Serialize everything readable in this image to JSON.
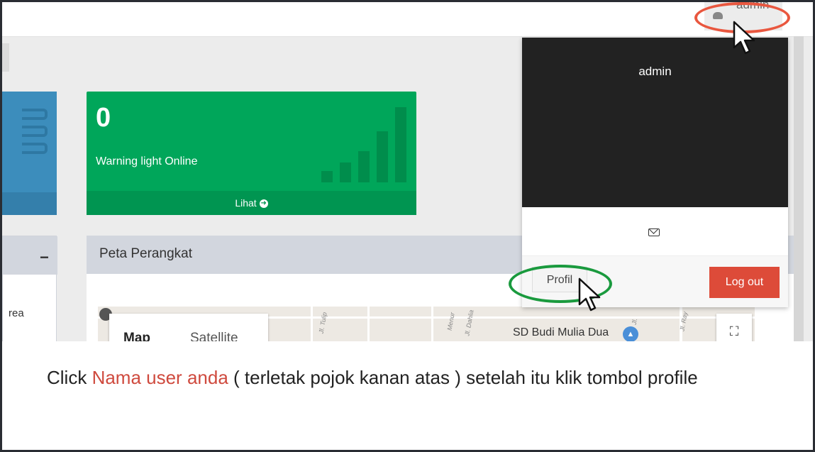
{
  "topbar": {
    "username": "admin"
  },
  "green_box": {
    "count": "0",
    "label": "Warning light Online",
    "link": "Lihat"
  },
  "left_panel": {
    "collapse": "−",
    "fragment": "rea"
  },
  "map_panel": {
    "title": "Peta Perangkat",
    "map_button": "Map",
    "satellite_button": "Satellite",
    "place": "SD Budi Mulia Dua",
    "streets": [
      "Jl. Tulip",
      "Jl. Dahlia",
      "Menur",
      "Jl.",
      "Jl. Ray"
    ]
  },
  "dropdown": {
    "name": "admin",
    "profile_button": "Profil",
    "logout_button": "Log out"
  },
  "instruction": {
    "prefix": "Click ",
    "highlight": "Nama user anda",
    "suffix": " ( terletak pojok kanan atas ) setelah itu klik tombol profile"
  },
  "colors": {
    "accent_red": "#e9573f",
    "accent_green": "#1a9a3e",
    "box_green": "#00a65a",
    "box_blue": "#3c8dbc",
    "logout_red": "#dd4b39"
  },
  "icons": [
    "user-avatar-icon",
    "arrow-circle-right-icon",
    "envelope-icon",
    "fullscreen-icon",
    "mouse-cursor-icon",
    "bar-chart-icon"
  ]
}
